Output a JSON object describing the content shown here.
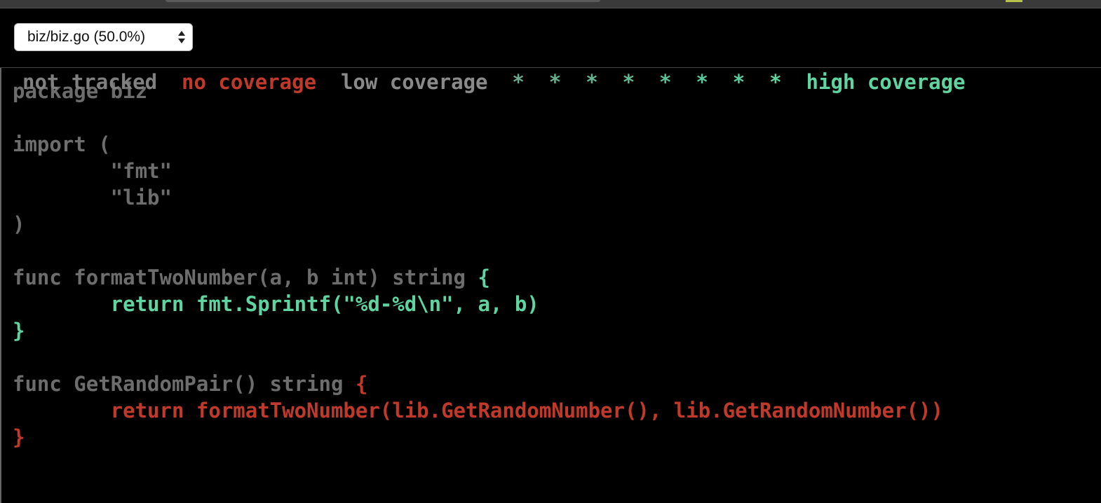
{
  "file_selector": {
    "selected": "biz/biz.go (50.0%)"
  },
  "legend": {
    "not_tracked": "not tracked",
    "no_coverage": "no coverage",
    "low_coverage": "low coverage",
    "stars": [
      "*",
      "*",
      "*",
      "*",
      "*",
      "*",
      "*",
      "*"
    ],
    "star_colors": [
      "#6fa88e",
      "#6aae90",
      "#66b492",
      "#62ba95",
      "#5ec098",
      "#5ac69b",
      "#58cc9e",
      "#5fd4a0"
    ],
    "high_coverage": "high coverage"
  },
  "colors": {
    "not_tracked": "#6d6d6d",
    "no_coverage": "#c0392b",
    "high_coverage": "#5fd4a0"
  },
  "code": {
    "line1": "package biz",
    "line2": "",
    "line3": "import (",
    "line4": "        \"fmt\"",
    "line5": "        \"lib\"",
    "line6": ")",
    "line7": "",
    "line8_plain": "func formatTwoNumber(a, b int) string ",
    "line8_covered": "{",
    "line9": "        return fmt.Sprintf(\"%d-%d\\n\", a, b)",
    "line10": "}",
    "line11": "",
    "line12_plain": "func GetRandomPair() string ",
    "line12_uncovered": "{",
    "line13": "        return formatTwoNumber(lib.GetRandomNumber(), lib.GetRandomNumber())",
    "line14": "}"
  }
}
